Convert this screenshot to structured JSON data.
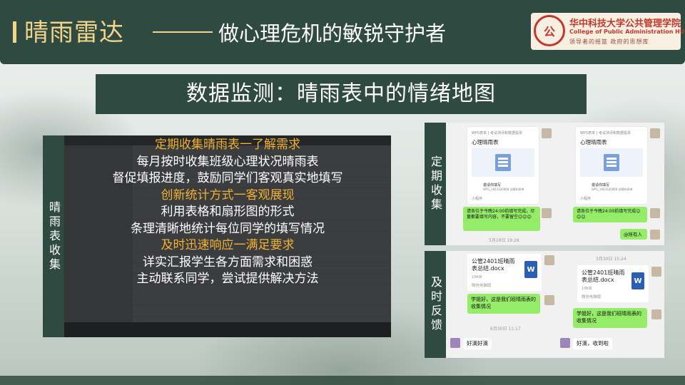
{
  "header": {
    "title": "晴雨雷达",
    "subtitle": "做心理危机的敏锐守护者",
    "logo": {
      "seal": "公",
      "name_cn": "华中科技大学公共管理学院",
      "name_en": "College of Public Administration HUST",
      "motto": "领导者的摇篮 政府的思想库"
    }
  },
  "banner": "数据监测：晴雨表中的情绪地图",
  "left_panel": {
    "label": "晴雨表收集",
    "lines": [
      {
        "text": "定期收集晴雨表一了解需求",
        "highlight": true
      },
      {
        "text": "每月按时收集班级心理状况晴雨表",
        "highlight": false
      },
      {
        "text": "督促填报进度，鼓励同学们客观真实地填写",
        "highlight": false
      },
      {
        "text": "创新统计方式一客观展现",
        "highlight": true
      },
      {
        "text": "利用表格和扇形图的形式",
        "highlight": false
      },
      {
        "text": "条理清晰地统计每位同学的填写情况",
        "highlight": false
      },
      {
        "text": "及时迅速响应一满足要求",
        "highlight": true
      },
      {
        "text": "详实汇报学生各方面需求和困惑",
        "highlight": false
      },
      {
        "text": "主动联系同学，尝试提供解决方法",
        "highlight": false
      }
    ]
  },
  "right_panel": {
    "collect_label": "定期收集",
    "feedback_label": "及时反馈",
    "collect_chat": {
      "card_header": "WPS表单 | 考试测评和数据投票",
      "card_title": "心理晴雨表",
      "invite": "邀请你填写",
      "invite_sub": "WPS_1663326868 创建的表单",
      "mini_program": "小程序",
      "reminder": "请各位于今晚24:00前填写完成，尽量都要填写内容，不要留空😊😊😊",
      "reminder2": "请各位于今晚24:00前填写完成😊😊😊",
      "mention": "@所有人",
      "timestamp": "5月19日 19:28"
    },
    "feedback_chat": {
      "file_name": "公管2401班晴雨表总结.docx",
      "file_size": "18KB",
      "file_source": "微信电脑版",
      "word_letter": "W",
      "reply1": "学姐好，这是我们班晴雨表的收集情况",
      "timestamp1": "3月30日 15:24",
      "timestamp2": "6月30日 11:17",
      "ack1": "好滴好滴",
      "ack2": "好滴，收到啦"
    }
  }
}
